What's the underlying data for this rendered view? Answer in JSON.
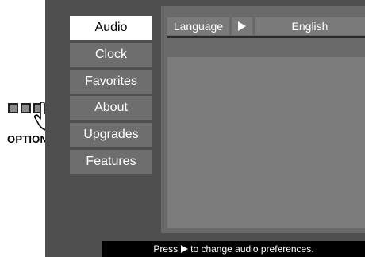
{
  "callout": {
    "label": "OPTIONS",
    "icon": "hand-pointer-icon"
  },
  "menu": {
    "items": [
      {
        "label": "Audio",
        "active": true
      },
      {
        "label": "Clock",
        "active": false
      },
      {
        "label": "Favorites",
        "active": false
      },
      {
        "label": "About",
        "active": false
      },
      {
        "label": "Upgrades",
        "active": false
      },
      {
        "label": "Features",
        "active": false
      }
    ]
  },
  "settings": {
    "language": {
      "label": "Language",
      "value": "English",
      "arrow_icon": "play-arrow-icon"
    }
  },
  "status": {
    "before": "Press",
    "after": "to change audio preferences.",
    "icon": "play-arrow-icon"
  },
  "colors": {
    "screen_bg": "#4f4f4f",
    "menu_item_bg": "#6e6e6e",
    "menu_active_bg": "#ffffff",
    "panel_bg": "#6a6a6a",
    "status_bg": "#000000"
  }
}
